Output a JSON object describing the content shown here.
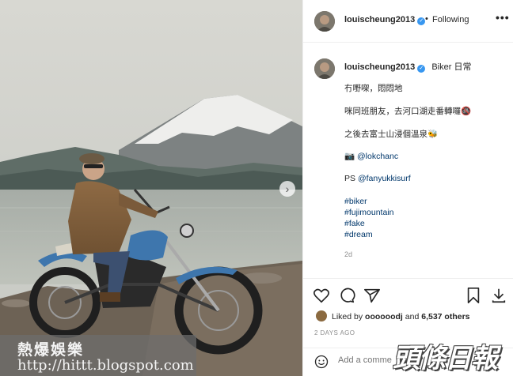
{
  "post": {
    "photo_alt": "Man on motorcycle by lake with Mount Fuji",
    "next_arrow_glyph": "›"
  },
  "header": {
    "username": "louischeung2013",
    "dot": "•",
    "follow_status": "Following",
    "more_glyph": "•••"
  },
  "caption": {
    "username": "louischeung2013",
    "title": "Biker 日常",
    "lines": [
      "冇嘢㗎，悶悶地",
      "咪同班朋友，去河口湖走番轉囉🚳",
      "之後去富士山浸個溫泉🐝"
    ],
    "camera_glyph": "📷",
    "photo_credit": "@lokchanc",
    "ps_label": "PS",
    "ps_mention": "@fanyukkisurf",
    "hashtags": [
      "#biker",
      "#fujimountain",
      "#fake",
      "#dream"
    ],
    "age": "2d"
  },
  "actions": {
    "liked_by_prefix": "Liked by",
    "liked_by_user": "oooooodj",
    "liked_by_and": "and",
    "liked_by_count": "6,537 others",
    "time_ago": "2 DAYS AGO",
    "comment_placeholder": "Add a comme"
  },
  "watermarks": {
    "blog_title": "熱爆娛樂",
    "blog_url": "http://hittt.blogspot.com",
    "news_logo": "頭條日報"
  },
  "colors": {
    "verified": "#3897f0",
    "link": "#00376b",
    "muted": "#8e8e8e",
    "border": "#efefef"
  }
}
